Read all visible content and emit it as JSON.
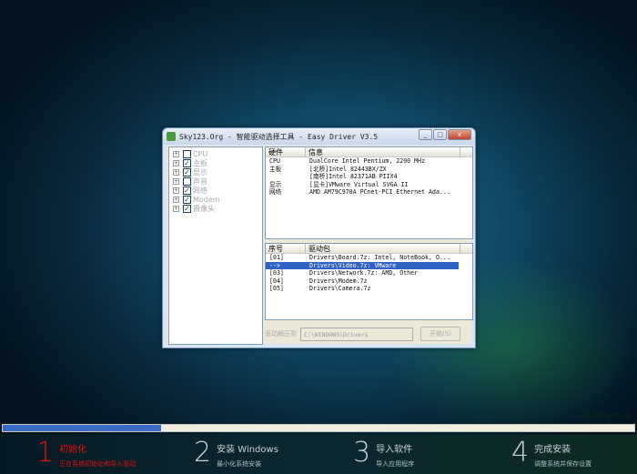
{
  "window": {
    "title": "Sky123.Org - 智能驱动选择工具 - Easy Driver V3.5",
    "buttons": [
      "_",
      "□",
      "x"
    ]
  },
  "tree": [
    {
      "label": "CPU",
      "checked": false
    },
    {
      "label": "主板",
      "checked": true
    },
    {
      "label": "显示",
      "checked": true
    },
    {
      "label": "声音",
      "checked": false
    },
    {
      "label": "网络",
      "checked": true
    },
    {
      "label": "Modem",
      "checked": true
    },
    {
      "label": "摄像头",
      "checked": true
    }
  ],
  "hardware": {
    "headers": [
      "硬件",
      "信息"
    ],
    "rows": [
      [
        "CPU",
        "DualCore Intel Pentium, 2200 MHz"
      ],
      [
        "主板",
        "[北桥]Intel 82443BX/ZX"
      ],
      [
        "",
        "[南桥]Intel 82371AB PIIX4"
      ],
      [
        "显示",
        "[显卡]VMware Virtual SVGA II"
      ],
      [
        "网络",
        "AMD AM79C970A PCnet-PCI Ethernet Ada..."
      ]
    ]
  },
  "drivers": {
    "headers": [
      "序号",
      "驱动包"
    ],
    "rows": [
      [
        "[01]",
        "Drivers\\Board.7z: Intel, NoteBook, O..."
      ],
      [
        "-->",
        "Drivers\\Video.7z: VMware"
      ],
      [
        "[03]",
        "Drivers\\Network.7z: AMD, Other"
      ],
      [
        "[04]",
        "Drivers\\Modem.7z"
      ],
      [
        "[05]",
        "Drivers\\Camera.7z"
      ]
    ],
    "selected": 1
  },
  "bottom": {
    "label": "驱动解压到",
    "path": "C:\\WINDOWS\\Drivers",
    "start": "开始(S)"
  },
  "installer": {
    "elapsed": "已用时间 00:26",
    "progress": 0.25,
    "steps": [
      {
        "num": "1",
        "title": "初始化",
        "sub": "正在系统初始化和导入驱动"
      },
      {
        "num": "2",
        "title": "安装 Windows",
        "sub": "最小化系统安装"
      },
      {
        "num": "3",
        "title": "导入软件",
        "sub": "导入应用程序"
      },
      {
        "num": "4",
        "title": "完成安装",
        "sub": "调整系统并保存设置"
      }
    ]
  }
}
